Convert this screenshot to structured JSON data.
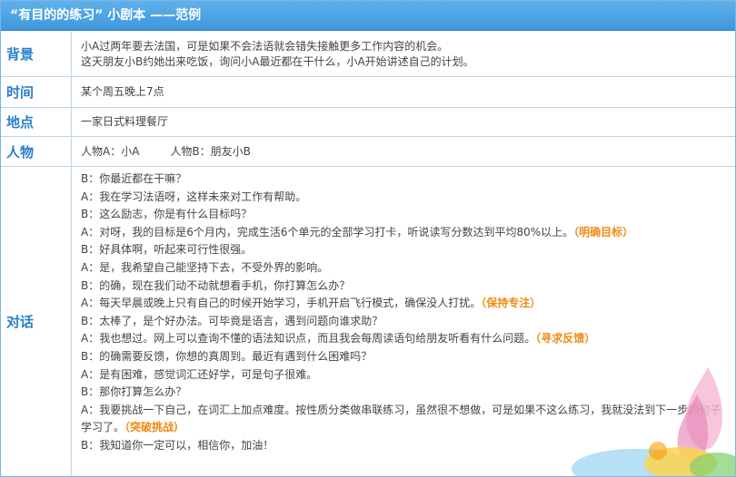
{
  "title": "“有目的的练习” 小剧本 ——范例",
  "rows": {
    "background": {
      "label": "背景",
      "lines": [
        "小A过两年要去法国，可是如果不会法语就会错失接触更多工作内容的机会。",
        "这天朋友小B约她出来吃饭，询问小A最近都在干什么，小A开始讲述自己的计划。"
      ]
    },
    "time": {
      "label": "时间",
      "text": "某个周五晚上7点"
    },
    "place": {
      "label": "地点",
      "text": "一家日式料理餐厅"
    },
    "persons": {
      "label": "人物",
      "a": "人物A：小A",
      "b": "人物B：朋友小B"
    },
    "dialog": {
      "label": "对话",
      "lines": [
        {
          "text": "B：你最近都在干嘛？",
          "tag": ""
        },
        {
          "text": "A：我在学习法语呀，这样未来对工作有帮助。",
          "tag": ""
        },
        {
          "text": "B：这么励志，你是有什么目标吗？",
          "tag": ""
        },
        {
          "text": "A：对呀，我的目标是6个月内，完成生活6个单元的全部学习打卡，听说读写分数达到平均80%以上。",
          "tag": "（明确目标）"
        },
        {
          "text": "B：好具体啊，听起来可行性很强。",
          "tag": ""
        },
        {
          "text": "A：是，我希望自己能坚持下去，不受外界的影响。",
          "tag": ""
        },
        {
          "text": "B：的确，现在我们动不动就想看手机，你打算怎么办？",
          "tag": ""
        },
        {
          "text": "A：每天早晨或晚上只有自己的时候开始学习，手机开启飞行模式，确保没人打扰。",
          "tag": "（保持专注）"
        },
        {
          "text": "B：太棒了，是个好办法。可毕竟是语言，遇到问题向谁求助？",
          "tag": ""
        },
        {
          "text": "A：我也想过。网上可以查询不懂的语法知识点，而且我会每周读语句给朋友听看有什么问题。",
          "tag": "（寻求反馈）"
        },
        {
          "text": "B：的确需要反馈，你想的真周到。最近有遇到什么困难吗？",
          "tag": ""
        },
        {
          "text": "A：是有困难，感觉词汇还好学，可是句子很难。",
          "tag": ""
        },
        {
          "text": "B：那你打算怎么办？",
          "tag": ""
        },
        {
          "text": "A：我要挑战一下自己，在词汇上加点难度。按性质分类做串联练习，虽然很不想做，可是如果不这么练习，我就没法到下一步的句子学习了。",
          "tag": "（突破挑战）"
        },
        {
          "text": "B：我知道你一定可以，相信你，加油！",
          "tag": ""
        }
      ]
    }
  },
  "colors": {
    "header": "#4aa3e2",
    "label": "#2a7fcb",
    "tag": "#f08a12",
    "border": "#b8d6ee"
  }
}
